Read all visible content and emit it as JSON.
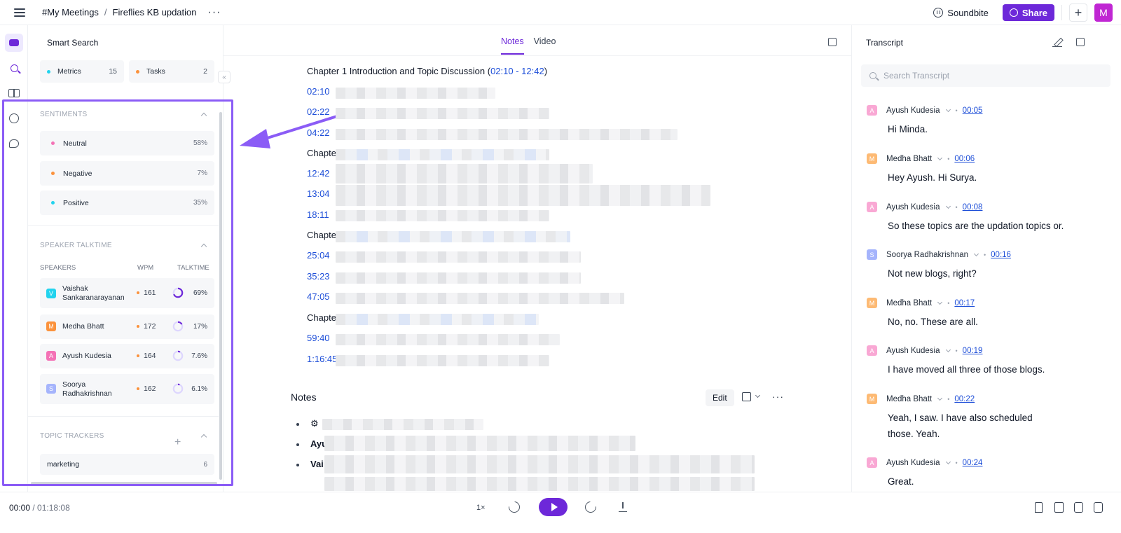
{
  "breadcrumb": {
    "channel": "#My Meetings",
    "separator": "/",
    "meeting": "Fireflies KB updation"
  },
  "header": {
    "soundbite_label": "Soundbite",
    "share_label": "Share",
    "user_initial": "M",
    "accent": "#6d28d9"
  },
  "smart_search": {
    "title": "Smart Search",
    "chips": [
      {
        "label": "Metrics",
        "count": "15",
        "color": "#22d3ee"
      },
      {
        "label": "Tasks",
        "count": "2",
        "color": "#fb923c"
      }
    ],
    "sentiments": {
      "title": "SENTIMENTS",
      "items": [
        {
          "label": "Neutral",
          "pct": "58%",
          "color": "#f472b6"
        },
        {
          "label": "Negative",
          "pct": "7%",
          "color": "#fb923c"
        },
        {
          "label": "Positive",
          "pct": "35%",
          "color": "#22d3ee"
        }
      ]
    },
    "talktime": {
      "title": "SPEAKER TALKTIME",
      "col_speakers": "SPEAKERS",
      "col_wpm": "WPM",
      "col_talktime": "TALKTIME",
      "speakers": [
        {
          "initial": "V",
          "name": "Vaishak Sankaranarayanan",
          "wpm": "161",
          "talktime": "69%",
          "fraction": 0.69,
          "color": "#22d3ee"
        },
        {
          "initial": "M",
          "name": "Medha Bhatt",
          "wpm": "172",
          "talktime": "17%",
          "fraction": 0.17,
          "color": "#fb923c"
        },
        {
          "initial": "A",
          "name": "Ayush Kudesia",
          "wpm": "164",
          "talktime": "7.6%",
          "fraction": 0.076,
          "color": "#f472b6"
        },
        {
          "initial": "S",
          "name": "Soorya Radhakrishnan",
          "wpm": "162",
          "talktime": "6.1%",
          "fraction": 0.061,
          "color": "#a5b4fc"
        }
      ]
    },
    "topics": {
      "title": "TOPIC TRACKERS",
      "items": [
        {
          "label": "marketing",
          "count": "6"
        }
      ]
    }
  },
  "center": {
    "tabs": [
      "Notes",
      "Video"
    ],
    "chapter1": {
      "prefix": "Chapter 1 Introduction and Topic Discussion (",
      "range": "02:10 - 12:42",
      "suffix": ")"
    },
    "chapter_prefix": "Chapte",
    "timestamps": [
      "02:10",
      "02:22",
      "04:22",
      "12:42",
      "13:04",
      "18:11",
      "25:04",
      "35:23",
      "47:05",
      "59:40",
      "1:16:45"
    ],
    "notes_title": "Notes",
    "edit_label": "Edit",
    "bullet_prefixes": [
      "Ayu",
      "Vai"
    ]
  },
  "transcript": {
    "title": "Transcript",
    "search_placeholder": "Search Transcript",
    "messages": [
      {
        "initial": "A",
        "speaker": "Ayush Kudesia",
        "time": "00:05",
        "text": "Hi Minda.",
        "color": "#f472b6"
      },
      {
        "initial": "M",
        "speaker": "Medha Bhatt",
        "time": "00:06",
        "text": "Hey Ayush. Hi Surya.",
        "color": "#fb923c"
      },
      {
        "initial": "A",
        "speaker": "Ayush Kudesia",
        "time": "00:08",
        "text": "So these topics are the updation topics or.",
        "color": "#f472b6"
      },
      {
        "initial": "S",
        "speaker": "Soorya Radhakrishnan",
        "time": "00:16",
        "text": "Not new blogs, right?",
        "color": "#a5b4fc"
      },
      {
        "initial": "M",
        "speaker": "Medha Bhatt",
        "time": "00:17",
        "text": "No, no. These are all.",
        "color": "#fb923c"
      },
      {
        "initial": "A",
        "speaker": "Ayush Kudesia",
        "time": "00:19",
        "text": "I have moved all three of those blogs.",
        "color": "#f472b6"
      },
      {
        "initial": "M",
        "speaker": "Medha Bhatt",
        "time": "00:22",
        "text": "Yeah, I saw. I have also scheduled those. Yeah.",
        "color": "#fb923c"
      },
      {
        "initial": "A",
        "speaker": "Ayush Kudesia",
        "time": "00:24",
        "text": "Great.",
        "color": "#f472b6"
      }
    ]
  },
  "player": {
    "current": "00:00",
    "sep": " / ",
    "total": "01:18:08",
    "speed": "1×"
  }
}
